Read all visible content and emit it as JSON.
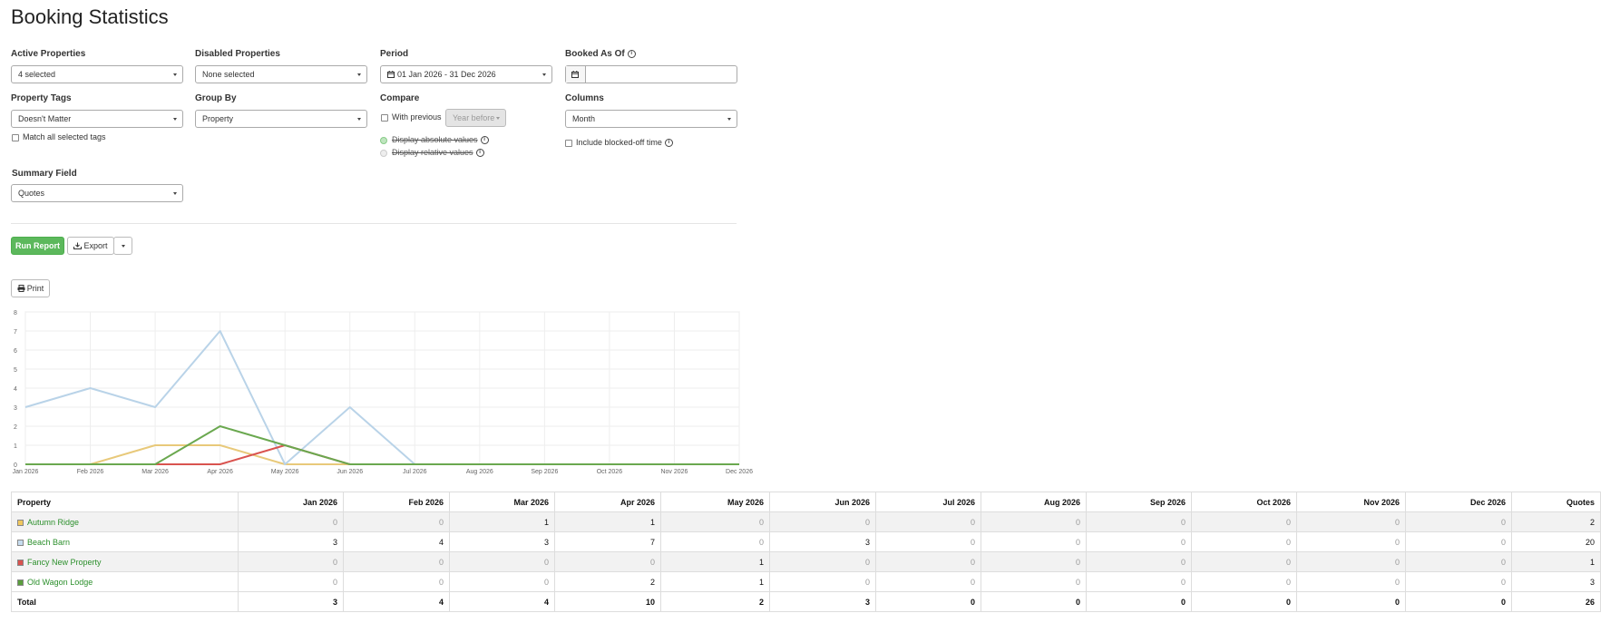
{
  "page_title": "Booking Statistics",
  "filters": {
    "active_properties": {
      "label": "Active Properties",
      "value": "4 selected"
    },
    "disabled_properties": {
      "label": "Disabled Properties",
      "value": "None selected"
    },
    "period": {
      "label": "Period",
      "value": "01 Jan 2026 - 31 Dec 2026"
    },
    "booked_as_of": {
      "label": "Booked As Of",
      "value": ""
    },
    "property_tags": {
      "label": "Property Tags",
      "value": "Doesn't Matter",
      "match_all_label": "Match all selected tags"
    },
    "group_by": {
      "label": "Group By",
      "value": "Property"
    },
    "compare": {
      "label": "Compare",
      "with_previous_label": "With previous",
      "with_previous_value": "Year before",
      "absolute_label": "Display absolute values",
      "relative_label": "Display relative values"
    },
    "columns": {
      "label": "Columns",
      "value": "Month",
      "include_blocked_label": "Include blocked-off time"
    },
    "summary_field": {
      "label": "Summary Field",
      "value": "Quotes"
    }
  },
  "actions": {
    "run_report": "Run Report",
    "export": "Export",
    "print": "Print"
  },
  "colors": {
    "run_button": "#5cb85c",
    "link": "#2c8f2c"
  },
  "chart_data": {
    "type": "line",
    "x": [
      "Jan 2026",
      "Feb 2026",
      "Mar 2026",
      "Apr 2026",
      "May 2026",
      "Jun 2026",
      "Jul 2026",
      "Aug 2026",
      "Sep 2026",
      "Oct 2026",
      "Nov 2026",
      "Dec 2026"
    ],
    "ylim": [
      0,
      8
    ],
    "yticks": [
      "0",
      "1",
      "2",
      "3",
      "4",
      "5",
      "6",
      "7",
      "8"
    ],
    "grid": true,
    "series": [
      {
        "name": "Autumn Ridge",
        "color": "#e8c97a",
        "values": [
          0,
          0,
          1,
          1,
          0,
          0,
          0,
          0,
          0,
          0,
          0,
          0
        ]
      },
      {
        "name": "Beach Barn",
        "color": "#b9d3e8",
        "values": [
          3,
          4,
          3,
          7,
          0,
          3,
          0,
          0,
          0,
          0,
          0,
          0
        ]
      },
      {
        "name": "Fancy New Property",
        "color": "#d9534f",
        "values": [
          0,
          0,
          0,
          0,
          1,
          0,
          0,
          0,
          0,
          0,
          0,
          0
        ]
      },
      {
        "name": "Old Wagon Lodge",
        "color": "#6aa84f",
        "values": [
          0,
          0,
          0,
          2,
          1,
          0,
          0,
          0,
          0,
          0,
          0,
          0
        ]
      }
    ]
  },
  "table": {
    "headers": [
      "Property",
      "Jan 2026",
      "Feb 2026",
      "Mar 2026",
      "Apr 2026",
      "May 2026",
      "Jun 2026",
      "Jul 2026",
      "Aug 2026",
      "Sep 2026",
      "Oct 2026",
      "Nov 2026",
      "Dec 2026",
      "Quotes"
    ],
    "rows": [
      {
        "name": "Autumn Ridge",
        "swatch": "#f0c75e",
        "cells": [
          "0",
          "0",
          "1",
          "1",
          "0",
          "0",
          "0",
          "0",
          "0",
          "0",
          "0",
          "0",
          "2"
        ]
      },
      {
        "name": "Beach Barn",
        "swatch": "#c6dcef",
        "cells": [
          "3",
          "4",
          "3",
          "7",
          "0",
          "3",
          "0",
          "0",
          "0",
          "0",
          "0",
          "0",
          "20"
        ]
      },
      {
        "name": "Fancy New Property",
        "swatch": "#d9534f",
        "cells": [
          "0",
          "0",
          "0",
          "0",
          "1",
          "0",
          "0",
          "0",
          "0",
          "0",
          "0",
          "0",
          "1"
        ]
      },
      {
        "name": "Old Wagon Lodge",
        "swatch": "#5a9e3d",
        "cells": [
          "0",
          "0",
          "0",
          "2",
          "1",
          "0",
          "0",
          "0",
          "0",
          "0",
          "0",
          "0",
          "3"
        ]
      }
    ],
    "total": {
      "label": "Total",
      "cells": [
        "3",
        "4",
        "4",
        "10",
        "2",
        "3",
        "0",
        "0",
        "0",
        "0",
        "0",
        "0",
        "26"
      ]
    }
  }
}
